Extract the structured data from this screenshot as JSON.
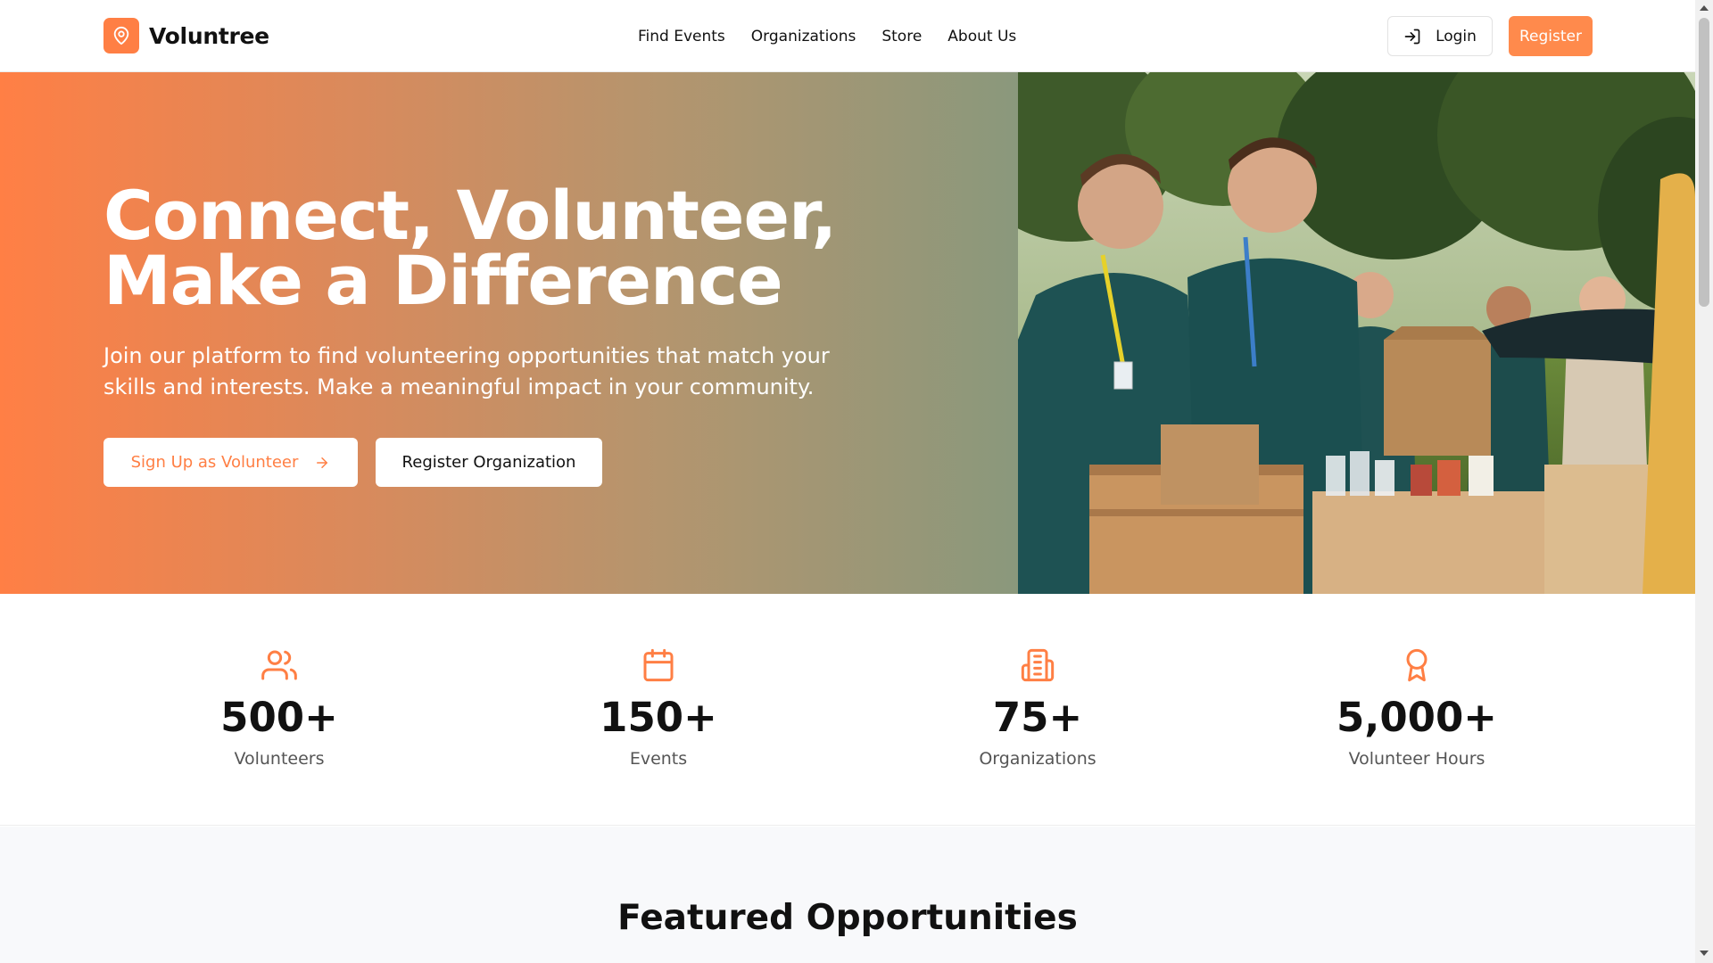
{
  "brand": {
    "name": "Voluntree",
    "icon": "map-pin-icon",
    "accent": "#ff7f44"
  },
  "nav": {
    "items": [
      {
        "label": "Find Events"
      },
      {
        "label": "Organizations"
      },
      {
        "label": "Store"
      },
      {
        "label": "About Us"
      }
    ],
    "login_label": "Login",
    "login_icon": "log-in-icon",
    "register_label": "Register"
  },
  "hero": {
    "title_line1": "Connect, Volunteer,",
    "title_line2": "Make a Difference",
    "subtitle": "Join our platform to find volunteering opportunities that match your skills and interests. Make a meaningful impact in your community.",
    "primary_cta": "Sign Up as Volunteer",
    "secondary_cta": "Register Organization",
    "image": "volunteers-handing-out-food-bags-photo"
  },
  "stats": [
    {
      "icon": "users-icon",
      "value": "500+",
      "label": "Volunteers"
    },
    {
      "icon": "calendar-icon",
      "value": "150+",
      "label": "Events"
    },
    {
      "icon": "building-icon",
      "value": "75+",
      "label": "Organizations"
    },
    {
      "icon": "award-icon",
      "value": "5,000+",
      "label": "Volunteer Hours"
    }
  ],
  "featured": {
    "title": "Featured Opportunities"
  },
  "colors": {
    "accent": "#ff7f44",
    "text": "#111111",
    "muted": "#555555"
  }
}
